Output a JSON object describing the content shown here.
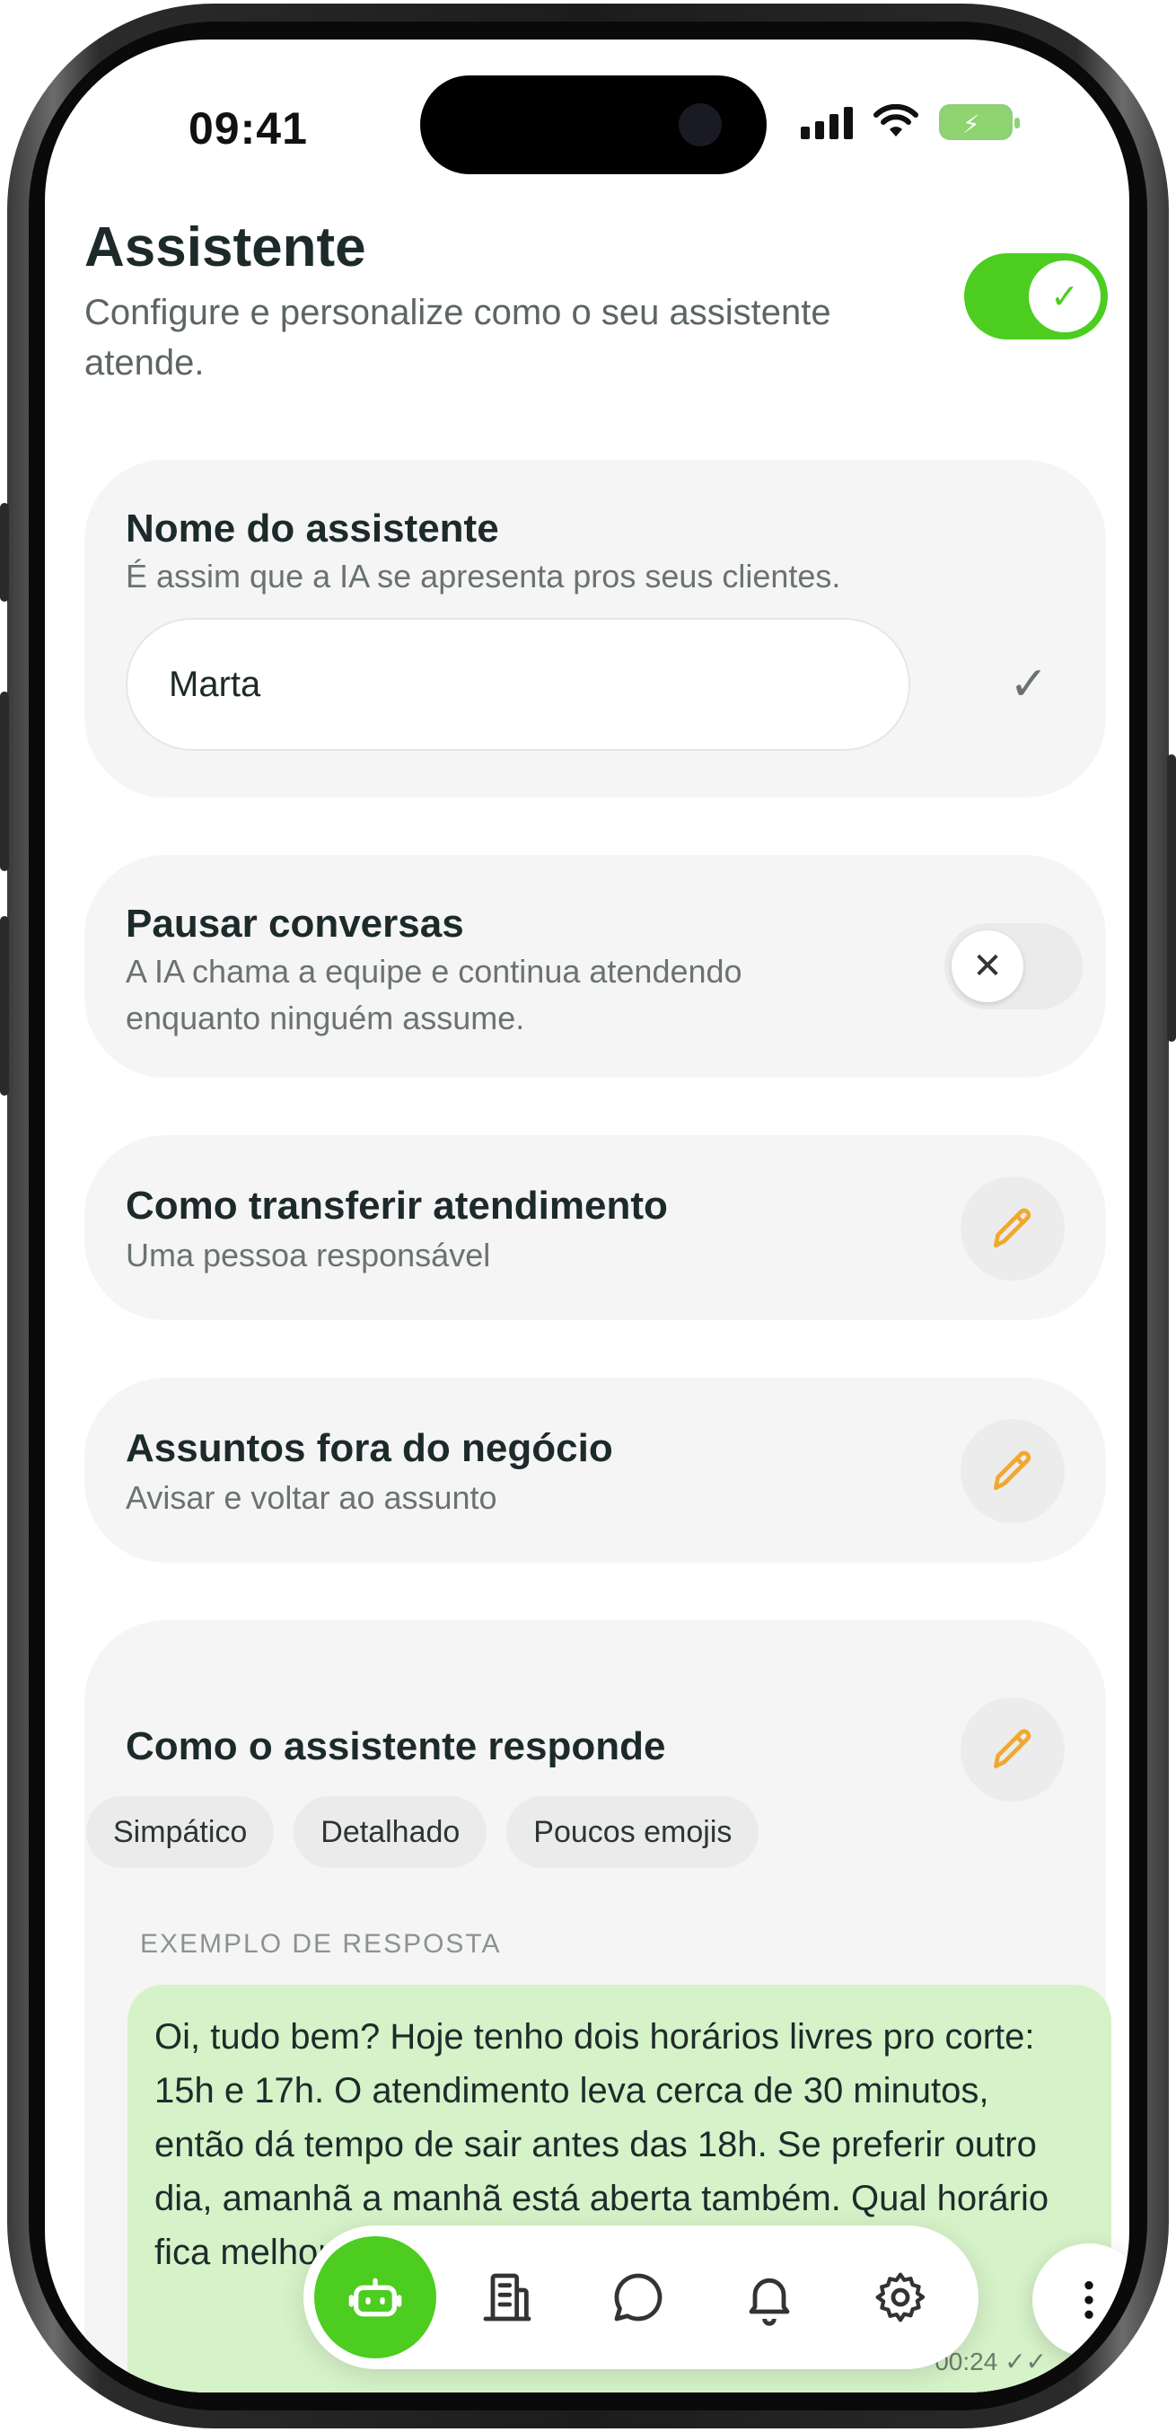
{
  "status_bar": {
    "time": "09:41"
  },
  "header": {
    "title": "Assistente",
    "subtitle": "Configure e personalize como o seu assistente atende.",
    "assistant_enabled": true
  },
  "assistant_name": {
    "title": "Nome do assistente",
    "description": "É assim que a IA se apresenta pros seus clientes.",
    "value": "Marta",
    "placeholder": ""
  },
  "pause_conversations": {
    "title": "Pausar conversas",
    "description": "A IA chama a equipe e continua atendendo enquanto ninguém assume.",
    "enabled": false
  },
  "transfer": {
    "title": "Como transferir atendimento",
    "description": "Uma pessoa responsável"
  },
  "off_topic": {
    "title": "Assuntos fora do negócio",
    "description": "Avisar e voltar ao assunto"
  },
  "response_style": {
    "title": "Como o assistente responde",
    "chips": [
      "Simpático",
      "Detalhado",
      "Poucos emojis"
    ],
    "example_label": "EXEMPLO DE RESPOSTA",
    "example_text": "Oi, tudo bem? Hoje tenho dois horários livres pro corte: 15h e 17h. O atendimento leva cerca de 30 minutos, então dá tempo de sair antes das 18h. Se preferir outro dia, amanhã a manhã está aberta também. Qual horário fica melhor pra você?",
    "example_time": "00:24"
  },
  "nav": {
    "items": [
      "robot-icon",
      "building-icon",
      "chat-bubble-icon",
      "bell-icon",
      "gear-icon"
    ],
    "active": "robot-icon"
  },
  "colors": {
    "accent": "#4ccd20",
    "edit_icon": "#f0a830",
    "bubble": "#d6f2c8"
  }
}
